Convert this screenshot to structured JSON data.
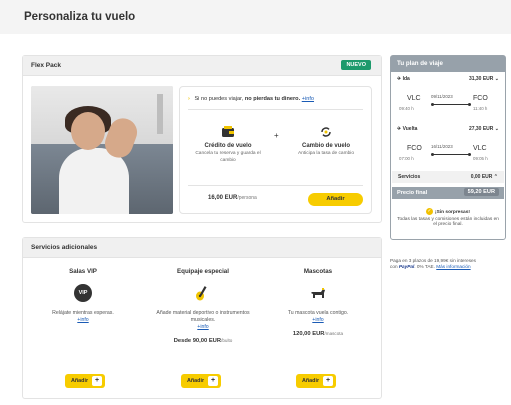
{
  "page": {
    "title": "Personaliza tu vuelo"
  },
  "flex_pack": {
    "header": "Flex Pack",
    "badge": "NUEVO",
    "promo_prefix": "Si no puedes viajar,",
    "promo_bold": "no pierdas tu dinero.",
    "promo_link": "+info",
    "feature1": {
      "icon": "wallet-icon",
      "title": "Crédito de vuelo",
      "desc": "Cancela tu reserva y guarda el cambio"
    },
    "plus": "+",
    "feature2": {
      "icon": "exchange-icon",
      "title": "Cambio de vuelo",
      "desc": "Anticipa la tasa de cambio"
    },
    "price": "16,00 EUR",
    "price_unit": "/persona",
    "add_label": "Añadir"
  },
  "services": {
    "header": "Servicios adicionales",
    "items": [
      {
        "title": "Salas VIP",
        "icon_text": "VIP",
        "desc": "Relájate mientras esperas.",
        "link": "+info",
        "price": "",
        "unit": "",
        "add_label": "Añadir",
        "plus": "+"
      },
      {
        "title": "Equipaje especial",
        "icon_text": "🎸",
        "desc": "Añade material deportivo o instrumentos musicales.",
        "link": "+info",
        "price": "Desde 90,00 EUR",
        "unit": "/bulto",
        "add_label": "Añadir",
        "plus": "+"
      },
      {
        "title": "Mascotas",
        "icon_text": "🐕",
        "desc": "Tu mascota vuela contigo.",
        "link": "+info",
        "price": "120,00 EUR",
        "unit": "/mascota",
        "add_label": "Añadir",
        "plus": "+"
      }
    ]
  },
  "plan": {
    "header": "Tu plan de viaje",
    "ida": {
      "label": "Ida",
      "price": "31,30 EUR",
      "from": "VLC",
      "to": "FCO",
      "date": "09/11/2023",
      "dep": "09:40 h",
      "arr": "11:40 h"
    },
    "vuelta": {
      "label": "Vuelta",
      "price": "27,30 EUR",
      "from": "FCO",
      "to": "VLC",
      "date": "16/11/2023",
      "dep": "07:00 h",
      "arr": "09:05 h"
    },
    "servicios": {
      "label": "Servicios",
      "price": "0,00 EUR"
    },
    "final": {
      "label": "Precio final",
      "price": "59,20 EUR"
    },
    "no_surprises_title": "¡Sin sorpresas!",
    "no_surprises_desc": "Todas las tasas y comisiones están incluidas en el precio final."
  },
  "paypal": {
    "line1": "Paga en 3 plazos de 19,99€ sin intereses",
    "with": "con",
    "brand": "PayPal",
    "tae": ". 0% TAE.",
    "link": "Más información"
  }
}
